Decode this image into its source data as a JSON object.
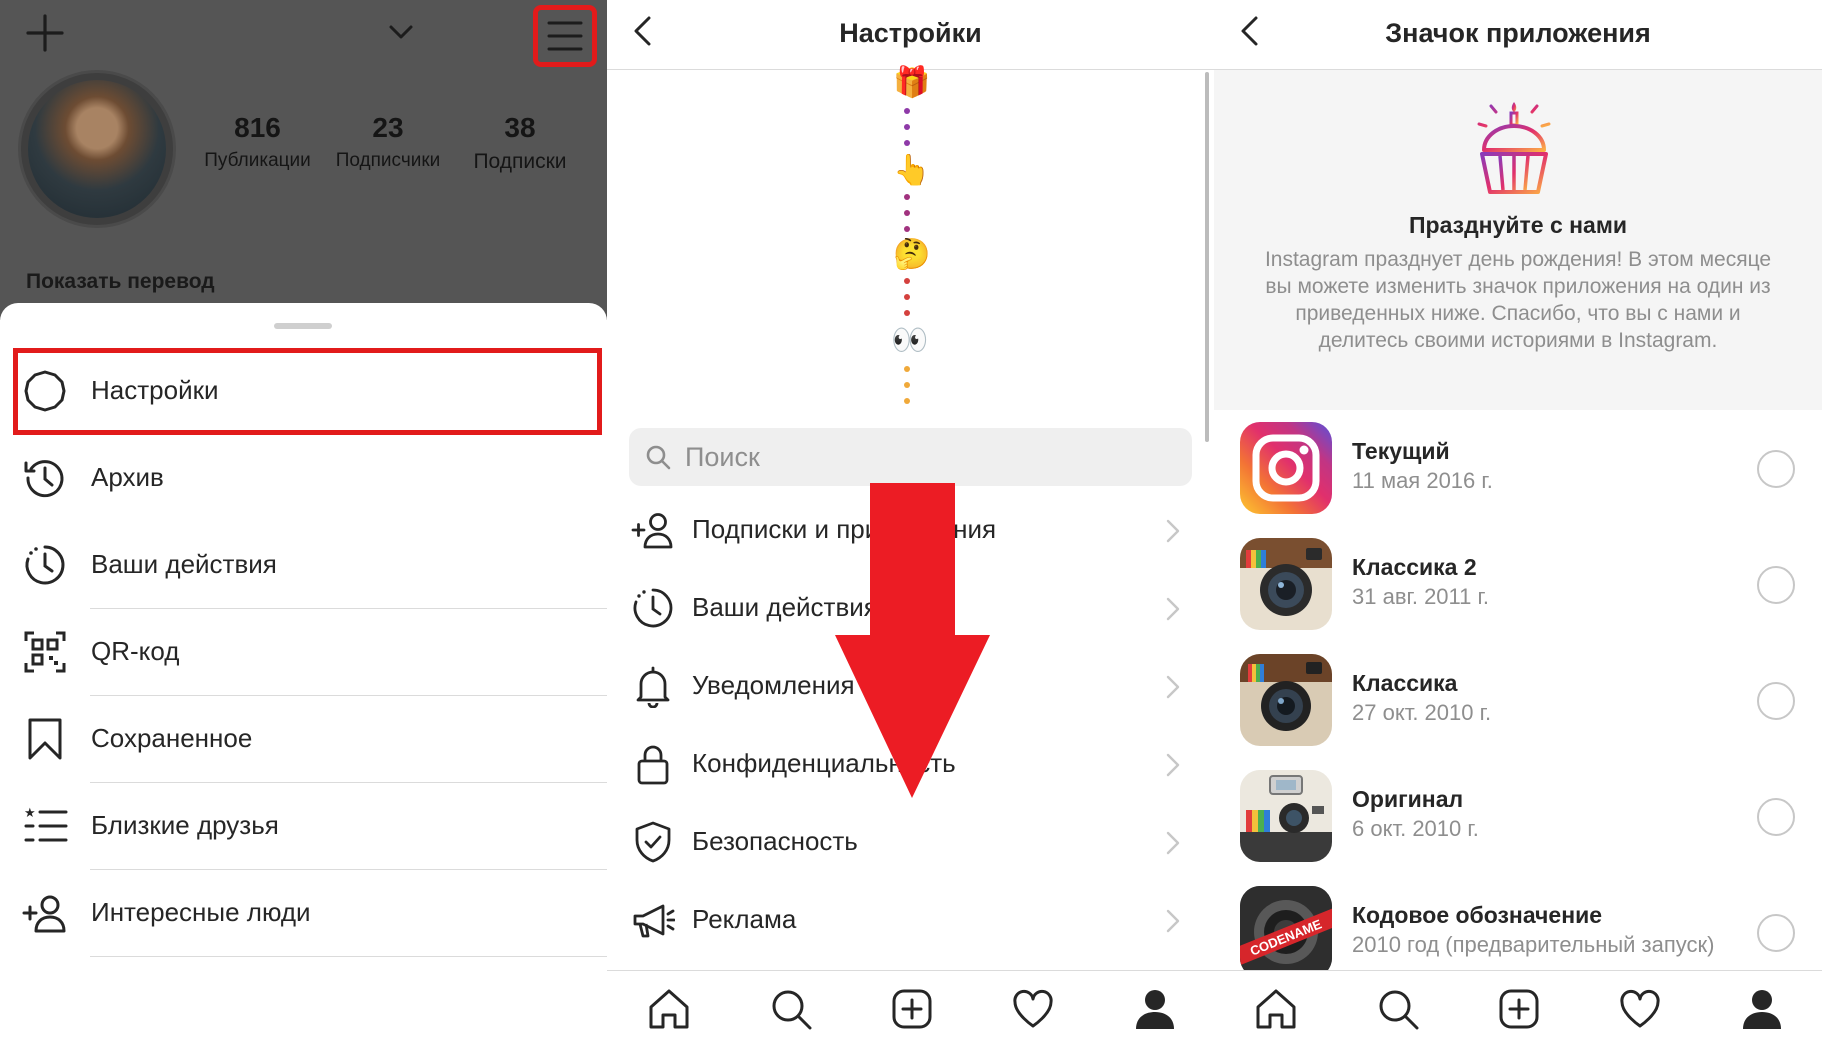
{
  "panel1": {
    "stats": [
      {
        "value": "816",
        "label": "Публикации"
      },
      {
        "value": "23",
        "label": "Подписчики"
      },
      {
        "value": "38",
        "label": "Подписки"
      }
    ],
    "translate_label": "Показать перевод",
    "menu_items": [
      {
        "label": "Настройки",
        "icon": "settings-icon"
      },
      {
        "label": "Архив",
        "icon": "archive-icon"
      },
      {
        "label": "Ваши действия",
        "icon": "activity-icon"
      },
      {
        "label": "QR-код",
        "icon": "qr-code-icon"
      },
      {
        "label": "Сохраненное",
        "icon": "bookmark-icon"
      },
      {
        "label": "Близкие друзья",
        "icon": "close-friends-icon"
      },
      {
        "label": "Интересные люди",
        "icon": "add-person-icon"
      }
    ],
    "highlight_color": "#e21b1b"
  },
  "panel2": {
    "title": "Настройки",
    "emojis": [
      "🎁",
      "👆",
      "🤔",
      "👀"
    ],
    "search_placeholder": "Поиск",
    "items": [
      {
        "label": "Подписки и приглашения",
        "icon": "follow-invite-icon"
      },
      {
        "label": "Ваши действия",
        "icon": "activity-icon"
      },
      {
        "label": "Уведомления",
        "icon": "bell-icon"
      },
      {
        "label": "Конфиденциальность",
        "icon": "lock-icon"
      },
      {
        "label": "Безопасность",
        "icon": "shield-icon"
      },
      {
        "label": "Реклама",
        "icon": "megaphone-icon"
      }
    ],
    "arrow_color": "#ec1c24"
  },
  "panel3": {
    "title": "Значок приложения",
    "banner_heading": "Празднуйте с нами",
    "banner_text": "Instagram празднует день рождения! В этом месяце вы можете изменить значок приложения на один из приведенных ниже. Спасибо, что вы с нами и делитесь своими историями в Instagram.",
    "icons": [
      {
        "name": "Текущий",
        "date": "11 мая 2016 г.",
        "icon": "instagram-current-icon"
      },
      {
        "name": "Классика 2",
        "date": "31 авг. 2011 г.",
        "icon": "classic-2-icon"
      },
      {
        "name": "Классика",
        "date": "27 окт. 2010 г.",
        "icon": "classic-icon"
      },
      {
        "name": "Оригинал",
        "date": "6 окт. 2010 г.",
        "icon": "original-icon"
      },
      {
        "name": "Кодовое обозначение",
        "date": "2010 год (предварительный запуск)",
        "icon": "codename-icon",
        "badge": "CODENAME"
      }
    ]
  },
  "tabbar": [
    "home-icon",
    "search-icon",
    "new-post-icon",
    "activity-heart-icon",
    "profile-icon"
  ]
}
